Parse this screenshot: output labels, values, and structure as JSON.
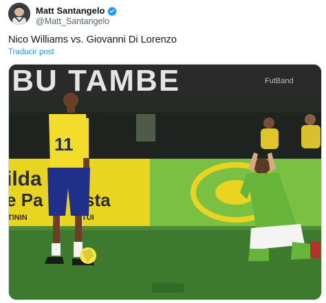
{
  "author": {
    "display_name": "Matt Santangelo",
    "handle": "@Matt_Santangelo",
    "verified": true
  },
  "tweet": {
    "text": "Nico Williams vs. Giovanni Di Lorenzo",
    "translate_label": "Traducir post"
  },
  "media": {
    "banner_text": "IBU TAMBE",
    "watermark_text": "FutBand",
    "board_left_lines": [
      "ilda",
      "e Pa",
      "TININ"
    ],
    "board_left_center_text": "sta",
    "board_left_small_text": "TUI",
    "player_number": "11",
    "corner_badge_text": "",
    "colors": {
      "pitch": "#3d7a2e",
      "board_yellow": "#e9d51f",
      "board_green": "#7ac043",
      "jersey_yellow": "#f3dd2a",
      "jersey_green": "#67b43a"
    }
  }
}
